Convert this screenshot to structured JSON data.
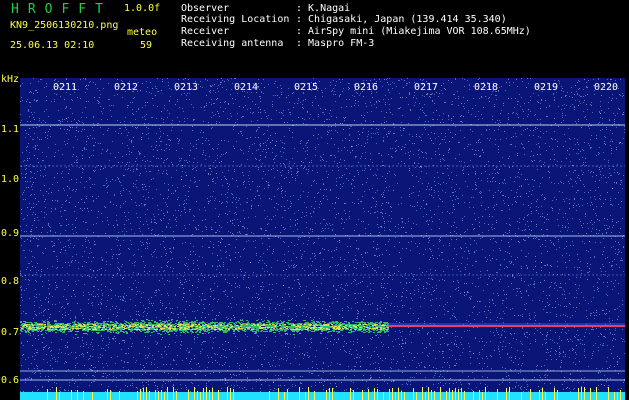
{
  "header": {
    "title": "HROFFT",
    "version": "1.0.0f",
    "filename": "KN9_2506130210.png",
    "meteo_label": "meteo",
    "datetime": "25.06.13 02:10",
    "count": "59"
  },
  "meta": [
    {
      "label": "Observer",
      "value": ": K.Nagai"
    },
    {
      "label": "Receiving Location",
      "value": ": Chigasaki, Japan (139.414 35.340)"
    },
    {
      "label": "Receiver",
      "value": ": AirSpy mini (Miakejima VOR 108.65MHz)"
    },
    {
      "label": "Receiving antenna",
      "value": ": Maspro FM-3"
    }
  ],
  "axis": {
    "y_unit": "kHz",
    "y_ticks": [
      "1.1",
      "1.0",
      "0.9",
      "0.8",
      "0.7",
      "0.6"
    ],
    "x_ticks": [
      "0211",
      "0212",
      "0213",
      "0214",
      "0215",
      "0216",
      "0217",
      "0218",
      "0219",
      "0220"
    ]
  },
  "colors": {
    "background": "#0a1578",
    "noise": "#7fb4ff",
    "tone_line": "#c8e8ff",
    "band": "#3fe06a",
    "band_hot": "#ff4466",
    "axis_text": "#ffff44",
    "footer": "#22e0ff"
  }
}
